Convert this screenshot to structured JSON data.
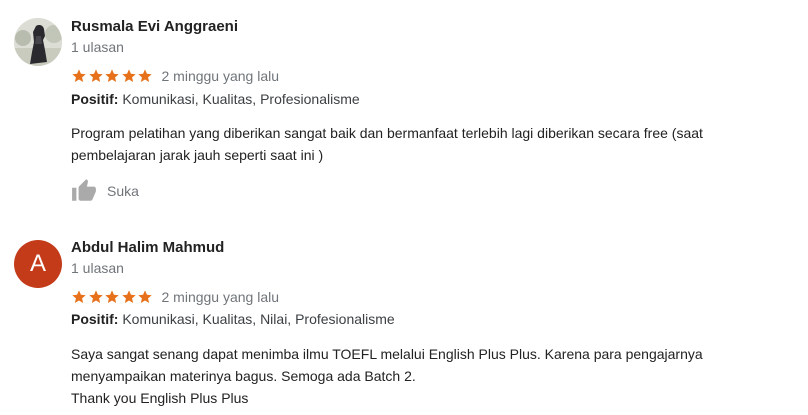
{
  "colors": {
    "star": "#e7711b",
    "secondary_text": "#70757a",
    "avatar_letter_bg": "#c43b1a",
    "like_icon": "#aaaaaa"
  },
  "reviews": [
    {
      "avatar_type": "photo",
      "name": "Rusmala Evi Anggraeni",
      "count": "1 ulasan",
      "rating": 5,
      "date": "2 minggu yang lalu",
      "positive_label": "Positif:",
      "positive_value": "Komunikasi, Kualitas, Profesionalisme",
      "body_lines": [
        "Program pelatihan yang diberikan sangat baik dan bermanfaat terlebih lagi diberikan secara free (saat",
        "pembelajaran jarak jauh seperti saat ini )"
      ],
      "like_label": "Suka",
      "like_icon": "thumb-up-icon"
    },
    {
      "avatar_type": "letter",
      "avatar_letter": "A",
      "name": "Abdul Halim Mahmud",
      "count": "1 ulasan",
      "rating": 5,
      "date": "2 minggu yang lalu",
      "positive_label": "Positif:",
      "positive_value": "Komunikasi, Kualitas, Nilai, Profesionalisme",
      "body_lines": [
        "Saya sangat senang dapat menimba ilmu TOEFL melalui English Plus Plus. Karena para pengajarnya",
        "menyampaikan materinya bagus. Semoga ada Batch 2.",
        "Thank you English Plus Plus"
      ]
    }
  ]
}
